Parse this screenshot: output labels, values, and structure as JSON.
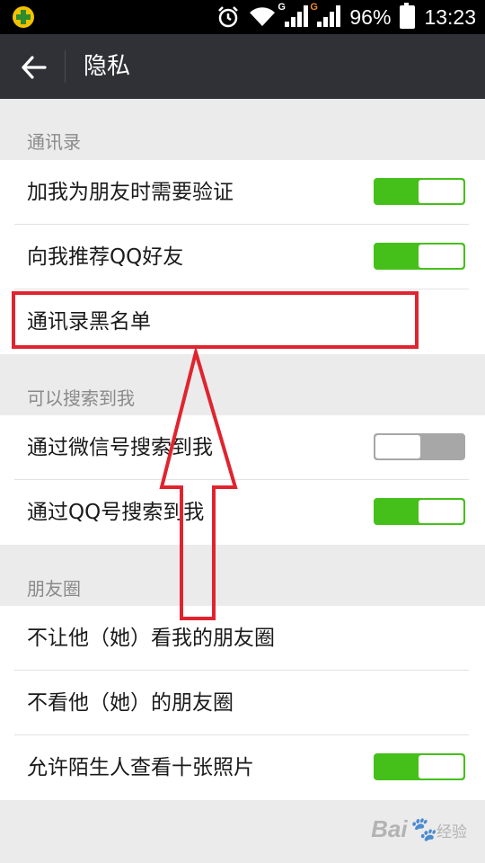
{
  "status_bar": {
    "battery": "96%",
    "time": "13:23",
    "network1": "G",
    "network2": "G",
    "icons": [
      "app-icon",
      "alarm-icon",
      "wifi-icon",
      "signal-icon",
      "battery-icon"
    ]
  },
  "header": {
    "title": "隐私",
    "back_icon": "back-arrow-icon"
  },
  "sections": [
    {
      "label": "通讯录",
      "items": [
        {
          "label": "加我为朋友时需要验证",
          "toggle": "on"
        },
        {
          "label": "向我推荐QQ好友",
          "toggle": "on"
        },
        {
          "label": "通讯录黑名单",
          "toggle": "none"
        }
      ]
    },
    {
      "label": "可以搜索到我",
      "items": [
        {
          "label": "通过微信号搜索到我",
          "toggle": "off"
        },
        {
          "label": "通过QQ号搜索到我",
          "toggle": "on"
        }
      ]
    },
    {
      "label": "朋友圈",
      "items": [
        {
          "label": "不让他（她）看我的朋友圈",
          "toggle": "none"
        },
        {
          "label": "不看他（她）的朋友圈",
          "toggle": "none"
        },
        {
          "label": "允许陌生人查看十张照片",
          "toggle": "on"
        }
      ]
    }
  ],
  "watermark": {
    "brand": "Bai",
    "suffix": "经验"
  },
  "colors": {
    "toggle_on": "#45c01a",
    "toggle_off": "#a7a7a7",
    "annotation": "#e0242f",
    "header_bg": "#2f3136"
  }
}
